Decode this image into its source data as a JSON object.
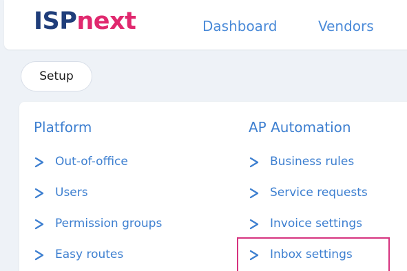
{
  "header": {
    "logo_part1": "ISP",
    "logo_part2": "next",
    "nav": [
      {
        "label": "Dashboard"
      },
      {
        "label": "Vendors"
      }
    ]
  },
  "setup_label": "Setup",
  "columns": [
    {
      "title": "Platform",
      "items": [
        {
          "label": "Out-of-office"
        },
        {
          "label": "Users"
        },
        {
          "label": "Permission groups"
        },
        {
          "label": "Easy routes"
        }
      ]
    },
    {
      "title": "AP Automation",
      "items": [
        {
          "label": "Business rules"
        },
        {
          "label": "Service requests"
        },
        {
          "label": "Invoice settings"
        },
        {
          "label": "Inbox settings"
        }
      ]
    }
  ],
  "colors": {
    "brand_navy": "#1f3d7a",
    "brand_pink": "#e0286e",
    "link_blue": "#3d7fd0",
    "highlight": "#d6337f"
  }
}
